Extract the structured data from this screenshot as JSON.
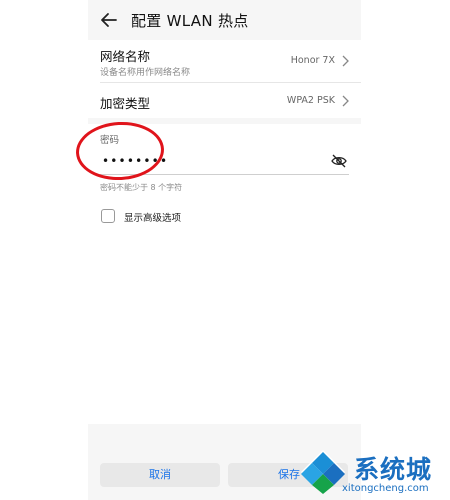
{
  "header": {
    "title": "配置 WLAN 热点",
    "back_icon": "back-arrow-icon"
  },
  "network_name": {
    "label": "网络名称",
    "sub": "设备名称用作网络名称",
    "value": "Honor 7X"
  },
  "encryption": {
    "label": "加密类型",
    "value": "WPA2 PSK"
  },
  "password": {
    "label": "密码",
    "value": "••••••••",
    "hint": "密码不能少于 8 个字符",
    "visibility_icon": "eye-off-icon"
  },
  "advanced": {
    "label": "显示高级选项",
    "checked": false
  },
  "buttons": {
    "cancel": "取消",
    "save": "保存"
  },
  "watermark": {
    "text": "系统城",
    "url": "xitongcheng.com"
  },
  "colors": {
    "accent": "#1a73e8",
    "annotation": "#e0141b",
    "watermark": "#1b6fc0"
  }
}
